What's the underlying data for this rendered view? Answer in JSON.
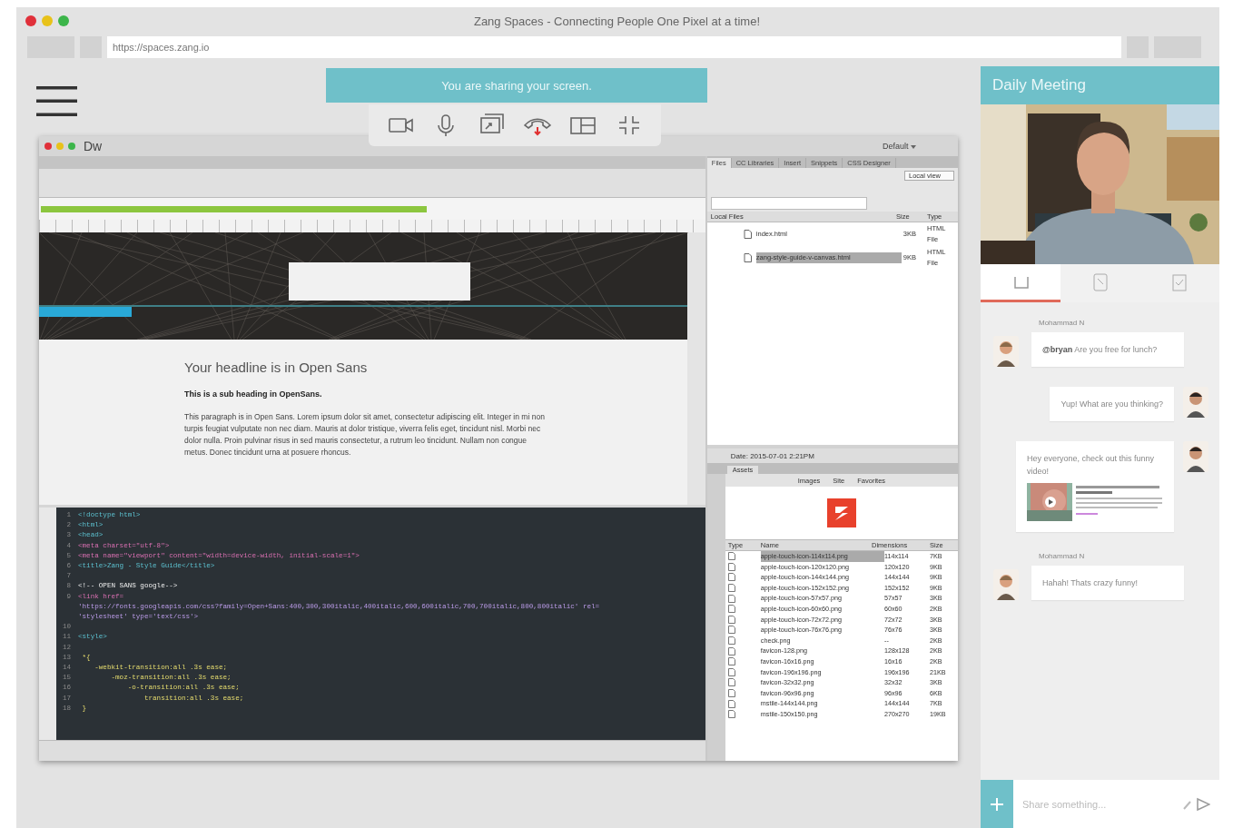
{
  "window": {
    "title": "Zang Spaces - Connecting People One Pixel at a time!",
    "url": "https://spaces.zang.io"
  },
  "share_banner": {
    "text": "You are sharing your screen."
  },
  "dreamweaver": {
    "app_label": "Dw",
    "workspace": "Default",
    "progress": {
      "level": 0.59
    },
    "design_view": {
      "headline": "Your headline is in Open Sans",
      "subheading": "This is a sub heading in OpenSans.",
      "paragraph": "This paragraph is in Open Sans. Lorem ipsum dolor sit amet, consectetur adipiscing elit. Integer in mi non turpis feugiat vulputate non nec diam. Mauris at dolor tristique, viverra felis eget, tincidunt nisl. Morbi nec dolor nulla. Proin pulvinar risus in sed mauris consectetur, a rutrum leo tincidunt. Nullam non congue metus. Donec tincidunt urna at posuere rhoncus."
    },
    "code_lines": [
      {
        "number": "1",
        "text": "<!doctype html>",
        "kind": "tag"
      },
      {
        "number": "2",
        "text": "<html>",
        "kind": "tag"
      },
      {
        "number": "3",
        "text": "<head>",
        "kind": "tag"
      },
      {
        "number": "4",
        "text": "<meta charset=\"utf-8\">",
        "kind": "meta"
      },
      {
        "number": "5",
        "text": "<meta name=\"viewport\" content=\"width=device-width, initial-scale=1\">",
        "kind": "meta"
      },
      {
        "number": "6",
        "text": "<title>Zang - Style Guide</title>",
        "kind": "tag"
      },
      {
        "number": "7"
      },
      {
        "number": "8",
        "text": "<!-- OPEN SANS google-->",
        "kind": "comment"
      },
      {
        "number": "9",
        "text": "<link href=",
        "kind": "meta"
      },
      {
        "text": "'https://fonts.googleapis.com/css?family=Open+Sans:400,300,300italic,400italic,600,600italic,700,700italic,800,800italic' rel=",
        "kind": "string"
      },
      {
        "text": "'stylesheet' type='text/css'>",
        "kind": "string"
      },
      {
        "number": "10"
      },
      {
        "number": "11",
        "text": "<style>",
        "kind": "tag"
      },
      {
        "number": "12"
      },
      {
        "number": "13",
        "text": " *{",
        "kind": "css"
      },
      {
        "number": "14",
        "text": "    -webkit-transition:all .3s ease;",
        "kind": "css"
      },
      {
        "number": "15",
        "text": "        -moz-transition:all .3s ease;",
        "kind": "css"
      },
      {
        "number": "16",
        "text": "            -o-transition:all .3s ease;",
        "kind": "css"
      },
      {
        "number": "17",
        "text": "                transition:all .3s ease;",
        "kind": "css"
      },
      {
        "number": "18",
        "text": " }",
        "kind": "css"
      }
    ],
    "files_panel": {
      "tabs": [
        {
          "label": "Files",
          "selected": true
        },
        {
          "label": "CC Libraries",
          "selected": false
        },
        {
          "label": "Insert",
          "selected": false
        },
        {
          "label": "Snippets",
          "selected": false
        },
        {
          "label": "CSS Designer",
          "selected": false
        }
      ],
      "view": "Local view",
      "columns": [
        "Local Files",
        "Size",
        "Type"
      ],
      "rows": [
        {
          "name": "index.html",
          "size": "3KB",
          "type": "HTML File",
          "selected": false
        },
        {
          "name": "zang-style-guide-v-canvas.html",
          "size": "9KB",
          "type": "HTML File",
          "selected": true
        }
      ],
      "log": "Date: 2015-07-01 2:21PM"
    },
    "assets_panel": {
      "tab": "Assets",
      "filters": [
        "Images",
        "Site",
        "Favorites"
      ],
      "columns": [
        "Type",
        "Name",
        "Dimensions",
        "Size"
      ],
      "rows": [
        {
          "name": "apple-touch-icon-114x114.png",
          "dimensions": "114x114",
          "size": "7KB",
          "selected": true
        },
        {
          "name": "apple-touch-icon-120x120.png",
          "dimensions": "120x120",
          "size": "9KB",
          "selected": false
        },
        {
          "name": "apple-touch-icon-144x144.png",
          "dimensions": "144x144",
          "size": "9KB",
          "selected": false
        },
        {
          "name": "apple-touch-icon-152x152.png",
          "dimensions": "152x152",
          "size": "9KB",
          "selected": false
        },
        {
          "name": "apple-touch-icon-57x57.png",
          "dimensions": "57x57",
          "size": "3KB",
          "selected": false
        },
        {
          "name": "apple-touch-icon-60x60.png",
          "dimensions": "60x60",
          "size": "2KB",
          "selected": false
        },
        {
          "name": "apple-touch-icon-72x72.png",
          "dimensions": "72x72",
          "size": "3KB",
          "selected": false
        },
        {
          "name": "apple-touch-icon-76x76.png",
          "dimensions": "76x76",
          "size": "3KB",
          "selected": false
        },
        {
          "name": "check.png",
          "dimensions": "--",
          "size": "2KB",
          "selected": false
        },
        {
          "name": "favicon-128.png",
          "dimensions": "128x128",
          "size": "2KB",
          "selected": false
        },
        {
          "name": "favicon-16x16.png",
          "dimensions": "16x16",
          "size": "2KB",
          "selected": false
        },
        {
          "name": "favicon-196x196.png",
          "dimensions": "196x196",
          "size": "21KB",
          "selected": false
        },
        {
          "name": "favicon-32x32.png",
          "dimensions": "32x32",
          "size": "3KB",
          "selected": false
        },
        {
          "name": "favicon-96x96.png",
          "dimensions": "96x96",
          "size": "6KB",
          "selected": false
        },
        {
          "name": "mstile-144x144.png",
          "dimensions": "144x144",
          "size": "7KB",
          "selected": false
        },
        {
          "name": "mstile-150x150.png",
          "dimensions": "270x270",
          "size": "19KB",
          "selected": false
        }
      ]
    }
  },
  "meeting": {
    "title": "Daily Meeting",
    "tabs": [
      {
        "kind": "chat",
        "selected": true
      },
      {
        "kind": "notes",
        "selected": false
      },
      {
        "kind": "tasks",
        "selected": false
      }
    ],
    "messages": [
      {
        "kind": "received",
        "author": "Mohammad N",
        "text": "**@bryan** Are you free for lunch?"
      },
      {
        "kind": "sent",
        "text": "Yup! What are you thinking?"
      },
      {
        "kind": "sent",
        "text": "Hey everyone, check out this funny video!",
        "attachment": {
          "kind": "video"
        }
      },
      {
        "kind": "received",
        "author": "Mohammad N",
        "text": "Hahah! Thats crazy funny!"
      }
    ],
    "composer": {
      "placeholder": "Share something..."
    }
  }
}
